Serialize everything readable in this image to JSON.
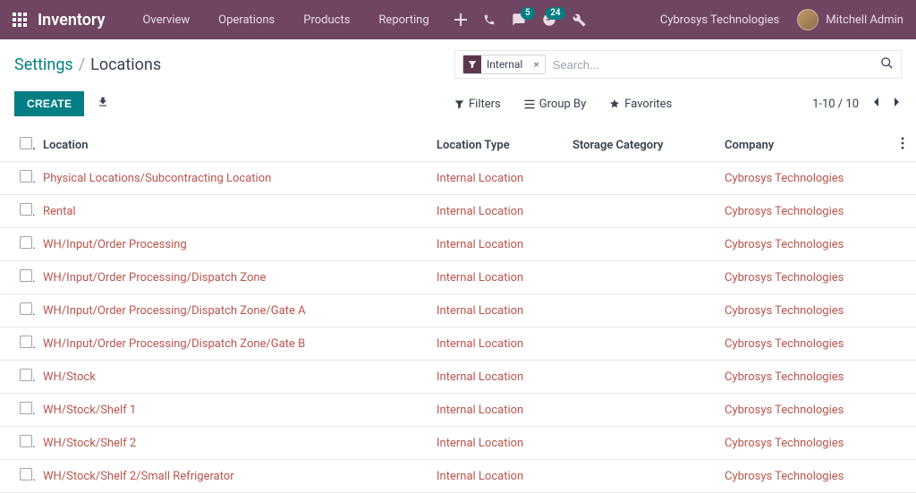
{
  "app_name": "Inventory",
  "nav": {
    "items": [
      "Overview",
      "Operations",
      "Products",
      "Reporting"
    ]
  },
  "badges": {
    "messages": "5",
    "activities": "24"
  },
  "company": "Cybrosys Technologies",
  "user": "Mitchell Admin",
  "breadcrumb": {
    "root": "Settings",
    "leaf": "Locations"
  },
  "search": {
    "facet": "Internal",
    "placeholder": "Search..."
  },
  "buttons": {
    "create": "CREATE"
  },
  "toolbar": {
    "filters": "Filters",
    "groupby": "Group By",
    "favorites": "Favorites"
  },
  "pager": "1-10 / 10",
  "columns": {
    "location": "Location",
    "type": "Location Type",
    "storage": "Storage Category",
    "company": "Company"
  },
  "rows": [
    {
      "location": "Physical Locations/Subcontracting Location",
      "type": "Internal Location",
      "storage": "",
      "company": "Cybrosys Technologies"
    },
    {
      "location": "Rental",
      "type": "Internal Location",
      "storage": "",
      "company": "Cybrosys Technologies"
    },
    {
      "location": "WH/Input/Order Processing",
      "type": "Internal Location",
      "storage": "",
      "company": "Cybrosys Technologies"
    },
    {
      "location": "WH/Input/Order Processing/Dispatch Zone",
      "type": "Internal Location",
      "storage": "",
      "company": "Cybrosys Technologies"
    },
    {
      "location": "WH/Input/Order Processing/Dispatch Zone/Gate A",
      "type": "Internal Location",
      "storage": "",
      "company": "Cybrosys Technologies"
    },
    {
      "location": "WH/Input/Order Processing/Dispatch Zone/Gate B",
      "type": "Internal Location",
      "storage": "",
      "company": "Cybrosys Technologies"
    },
    {
      "location": "WH/Stock",
      "type": "Internal Location",
      "storage": "",
      "company": "Cybrosys Technologies"
    },
    {
      "location": "WH/Stock/Shelf 1",
      "type": "Internal Location",
      "storage": "",
      "company": "Cybrosys Technologies"
    },
    {
      "location": "WH/Stock/Shelf 2",
      "type": "Internal Location",
      "storage": "",
      "company": "Cybrosys Technologies"
    },
    {
      "location": "WH/Stock/Shelf 2/Small Refrigerator",
      "type": "Internal Location",
      "storage": "",
      "company": "Cybrosys Technologies"
    }
  ]
}
